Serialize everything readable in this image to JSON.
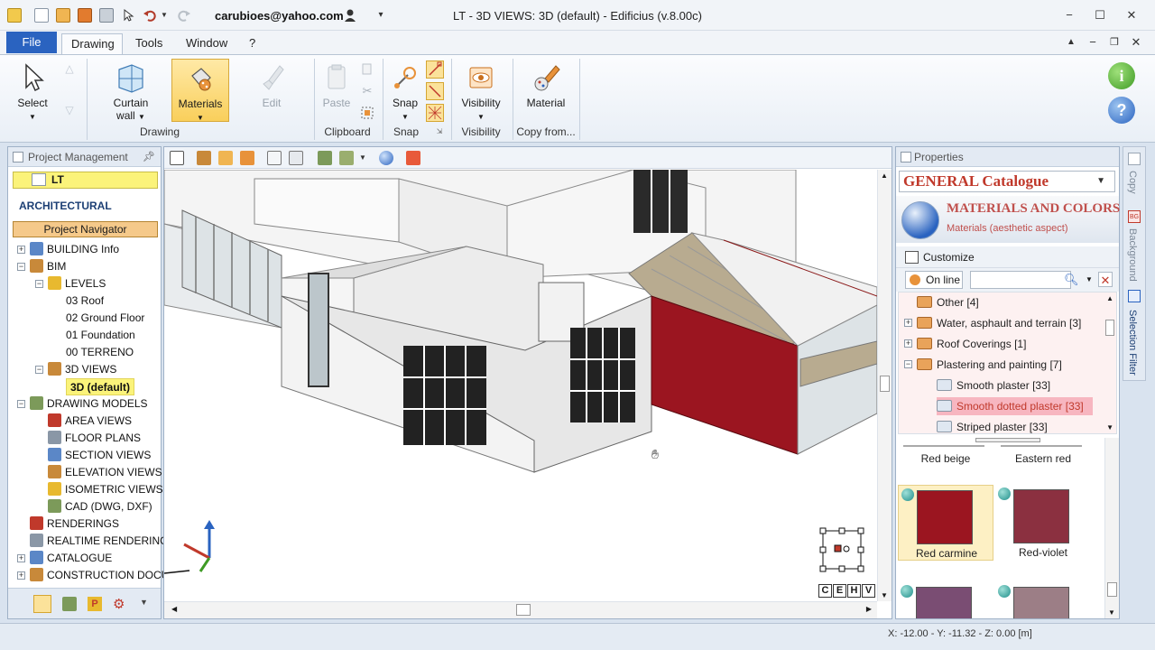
{
  "titlebar": {
    "user_email": "carubioes@yahoo.com",
    "title": "LT  -  3D VIEWS: 3D (default) - Edificius (v.8.00c)"
  },
  "menu": {
    "file": "File",
    "tabs": [
      "Drawing",
      "Tools",
      "Window",
      "?"
    ]
  },
  "ribbon": {
    "select": "Select",
    "curtain_wall": [
      "Curtain",
      "wall"
    ],
    "materials": "Materials",
    "edit": "Edit",
    "paste": "Paste",
    "snap": "Snap",
    "visibility": "Visibility",
    "material": "Material",
    "groups": {
      "drawing": "Drawing",
      "clipboard": "Clipboard",
      "snap": "Snap",
      "visibility": "Visibility",
      "copy_from": "Copy from..."
    }
  },
  "left_panel": {
    "header": "Project Management",
    "project": "LT",
    "section": "ARCHITECTURAL",
    "navigator": "Project Navigator",
    "tree": [
      {
        "label": "BUILDING Info",
        "level": 0,
        "exp": "+"
      },
      {
        "label": "BIM",
        "level": 0,
        "exp": "−"
      },
      {
        "label": "LEVELS",
        "level": 1,
        "exp": "−"
      },
      {
        "label": "03 Roof",
        "level": 2,
        "exp": ""
      },
      {
        "label": "02 Ground Floor",
        "level": 2,
        "exp": ""
      },
      {
        "label": "01 Foundation",
        "level": 2,
        "exp": ""
      },
      {
        "label": "00 TERRENO",
        "level": 2,
        "exp": ""
      },
      {
        "label": "3D VIEWS",
        "level": 1,
        "exp": "−"
      },
      {
        "label": "3D (default)",
        "level": 2,
        "exp": "",
        "selected": true
      },
      {
        "label": "DRAWING MODELS",
        "level": 0,
        "exp": "−"
      },
      {
        "label": "AREA VIEWS",
        "level": 1,
        "exp": ""
      },
      {
        "label": "FLOOR PLANS",
        "level": 1,
        "exp": ""
      },
      {
        "label": "SECTION VIEWS",
        "level": 1,
        "exp": ""
      },
      {
        "label": "ELEVATION VIEWS",
        "level": 1,
        "exp": ""
      },
      {
        "label": "ISOMETRIC VIEWS",
        "level": 1,
        "exp": ""
      },
      {
        "label": "CAD (DWG, DXF)",
        "level": 1,
        "exp": ""
      },
      {
        "label": "RENDERINGS",
        "level": 0,
        "exp": ""
      },
      {
        "label": "REALTIME RENDERING",
        "level": 0,
        "exp": ""
      },
      {
        "label": "CATALOGUE",
        "level": 0,
        "exp": "+"
      },
      {
        "label": "CONSTRUCTION DOCUM",
        "level": 0,
        "exp": "+"
      }
    ]
  },
  "viewport": {
    "view_buttons": [
      "C",
      "E",
      "H",
      "V"
    ]
  },
  "properties": {
    "header": "Properties",
    "catalogue": "GENERAL Catalogue",
    "title": "MATERIALS AND COLORS",
    "subtitle": "Materials (aesthetic aspect)",
    "customize": "Customize",
    "online": "On line",
    "search_placeholder": "",
    "categories": [
      {
        "label": "Other",
        "count": "[4]",
        "level": 0,
        "exp": ""
      },
      {
        "label": "Water, asphault and terrain",
        "count": "[3]",
        "level": 0,
        "exp": "+"
      },
      {
        "label": "Roof Coverings",
        "count": "[1]",
        "level": 0,
        "exp": "+"
      },
      {
        "label": "Plastering and painting",
        "count": "[7]",
        "level": 0,
        "exp": "−"
      },
      {
        "label": "Smooth plaster",
        "count": "[33]",
        "level": 1,
        "exp": ""
      },
      {
        "label": "Smooth dotted plaster",
        "count": "[33]",
        "level": 1,
        "exp": "",
        "selected": true
      },
      {
        "label": "Striped plaster",
        "count": "[33]",
        "level": 1,
        "exp": ""
      }
    ],
    "swatch_top_labels": [
      "Red beige",
      "Eastern red"
    ],
    "swatches": [
      {
        "label": "Red carmine",
        "color": "#9b1520",
        "selected": true
      },
      {
        "label": "Red-violet",
        "color": "#8b3040",
        "selected": false
      },
      {
        "label": "",
        "color": "#7a4d73",
        "selected": false
      },
      {
        "label": "",
        "color": "#9c7e86",
        "selected": false
      }
    ]
  },
  "side_tabs": [
    "Copy",
    "Background",
    "Selection Filter"
  ],
  "status": {
    "coords": "X: -12.00 - Y: -11.32 - Z: 0.00 [m]"
  }
}
